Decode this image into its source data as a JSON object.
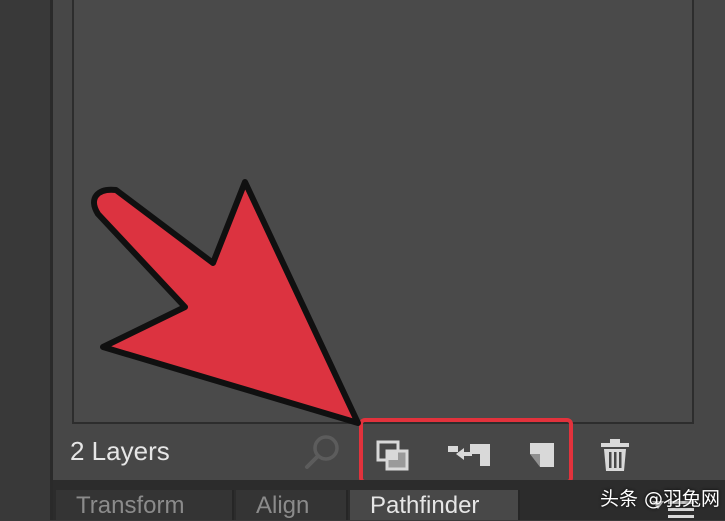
{
  "layers_panel": {
    "status": "2 Layers"
  },
  "bottom_tabs": {
    "transform": "Transform",
    "align": "Align",
    "pathfinder": "Pathfinder"
  },
  "watermark": "头条 @羽兔网",
  "icons": {
    "search": "search-icon",
    "merge_layers": "merge-layers-icon",
    "collect_layers": "collect-layers-icon",
    "new_layer": "new-layer-icon",
    "delete": "trash-icon",
    "panel_menu": "panel-menu-icon",
    "arrow": "pointer-arrow-graphic"
  },
  "colors": {
    "panel_bg": "#474747",
    "highlight_red": "#e2323c",
    "arrow_fill": "#dc3340",
    "text": "#e6e6e6"
  }
}
